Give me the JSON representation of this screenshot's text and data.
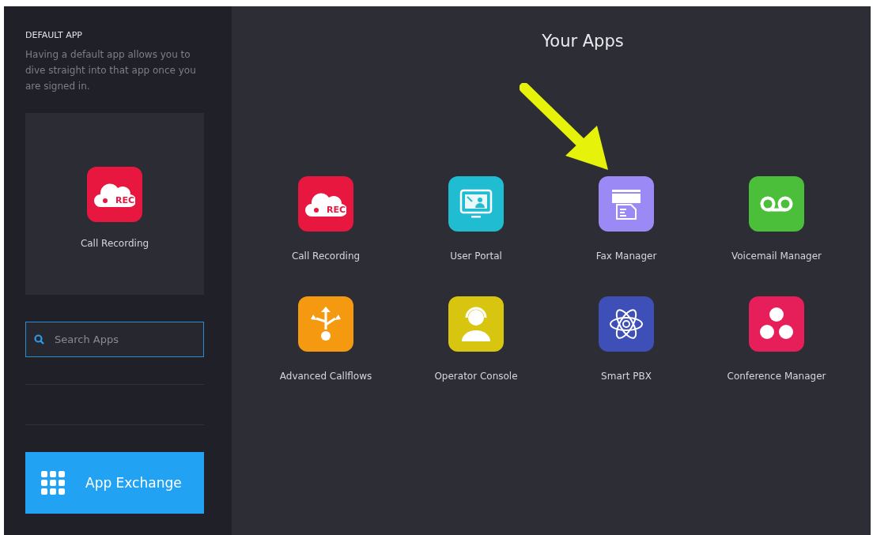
{
  "sidebar": {
    "heading": "DEFAULT APP",
    "description": "Having a default app allows you to dive straight into that app once you are signed in.",
    "default_app": {
      "name": "Call Recording",
      "kind": "recording",
      "color": "#e8173f",
      "badge": "REC"
    },
    "search": {
      "placeholder": "Search Apps"
    },
    "exchange_button": {
      "label": "App Exchange"
    }
  },
  "main": {
    "title": "Your Apps",
    "apps": [
      {
        "name": "Call Recording",
        "kind": "recording",
        "color": "#e8173f",
        "badge": "REC",
        "highlighted": false
      },
      {
        "name": "User Portal",
        "kind": "portal",
        "color": "#1fbcd2",
        "highlighted": false
      },
      {
        "name": "Fax Manager",
        "kind": "fax",
        "color": "#9b8af5",
        "highlighted": true
      },
      {
        "name": "Voicemail Manager",
        "kind": "voicemail",
        "color": "#4cbf3a",
        "highlighted": false
      },
      {
        "name": "Advanced Callflows",
        "kind": "callflows",
        "color": "#f59a10",
        "highlighted": false
      },
      {
        "name": "Operator Console",
        "kind": "operator",
        "color": "#d8c510",
        "highlighted": false
      },
      {
        "name": "Smart PBX",
        "kind": "pbx",
        "color": "#3f4fb8",
        "highlighted": false
      },
      {
        "name": "Conference Manager",
        "kind": "conference",
        "color": "#e61f5a",
        "highlighted": false
      }
    ]
  }
}
